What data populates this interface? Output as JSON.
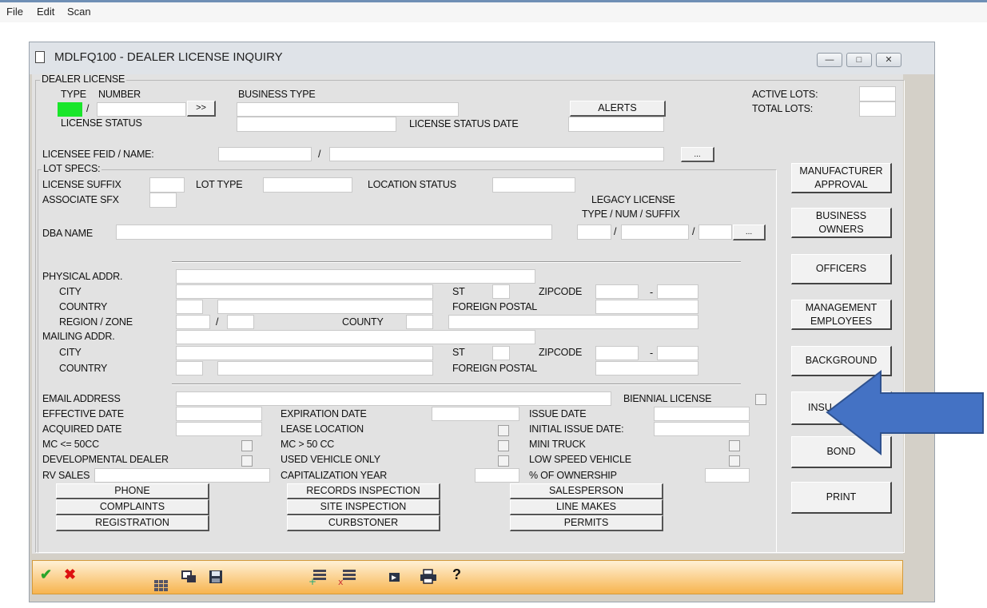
{
  "menu": [
    "File",
    "Edit",
    "Scan"
  ],
  "window": {
    "title": "MDLFQ100 - DEALER LICENSE INQUIRY",
    "controls": [
      "—",
      "□",
      "✕"
    ]
  },
  "dealer_license": {
    "group_label": "DEALER LICENSE",
    "type_label": "TYPE",
    "number_label": "NUMBER",
    "slash": "/",
    "lookup_button": ">>",
    "business_type_label": "BUSINESS TYPE",
    "alerts_button": "ALERTS",
    "active_lots_label": "ACTIVE LOTS:",
    "total_lots_label": "TOTAL LOTS:",
    "license_status_label": "LICENSE STATUS",
    "license_status_date_label": "LICENSE STATUS DATE",
    "type_indicator_color": "#19e62a"
  },
  "licensee": {
    "feid_label": "LICENSEE FEID / NAME:",
    "slash": "/",
    "browse_button": "..."
  },
  "lot_specs": {
    "group_label": "LOT SPECS:",
    "license_suffix_label": "LICENSE SUFFIX",
    "lot_type_label": "LOT TYPE",
    "location_status_label": "LOCATION STATUS",
    "associate_sfx_label": "ASSOCIATE SFX",
    "legacy_license_label": "LEGACY LICENSE",
    "legacy_sub_label": "TYPE / NUM / SUFFIX",
    "dba_name_label": "DBA NAME",
    "slash": "/",
    "browse_button": "..."
  },
  "address": {
    "physical_label": "PHYSICAL ADDR.",
    "city_label": "CITY",
    "st_label": "ST",
    "zipcode_label": "ZIPCODE",
    "dash": "-",
    "country_label": "COUNTRY",
    "foreign_postal_label": "FOREIGN POSTAL",
    "region_label": "REGION / ZONE",
    "county_label": "COUNTY",
    "slash": "/",
    "mailing_label": "MAILING ADDR."
  },
  "details": {
    "email_label": "EMAIL ADDRESS",
    "biennial_label": "BIENNIAL LICENSE",
    "effective_date_label": "EFFECTIVE DATE",
    "expiration_date_label": "EXPIRATION DATE",
    "issue_date_label": "ISSUE DATE",
    "acquired_date_label": "ACQUIRED DATE",
    "lease_location_label": "LEASE LOCATION",
    "initial_issue_date_label": "INITIAL ISSUE DATE:",
    "mc_le_50_label": "MC <= 50CC",
    "mc_gt_50_label": "MC > 50 CC",
    "mini_truck_label": "MINI TRUCK",
    "developmental_label": "DEVELOPMENTAL DEALER",
    "used_vehicle_label": "USED VEHICLE ONLY",
    "low_speed_label": "LOW SPEED VEHICLE",
    "rv_sales_label": "RV SALES",
    "capitalization_label": "CAPITALIZATION YEAR",
    "ownership_label": "% OF OWNERSHIP"
  },
  "bottom_buttons": {
    "phone": "PHONE",
    "complaints": "COMPLAINTS",
    "registration": "REGISTRATION",
    "records_inspection": "RECORDS INSPECTION",
    "site_inspection": "SITE INSPECTION",
    "curbstoner": "CURBSTONER",
    "salesperson": "SALESPERSON",
    "line_makes": "LINE MAKES",
    "permits": "PERMITS"
  },
  "side_buttons": {
    "manufacturer_1": "MANUFACTURER",
    "manufacturer_2": "APPROVAL",
    "business_1": "BUSINESS",
    "business_2": "OWNERS",
    "officers": "OFFICERS",
    "management_1": "MANAGEMENT",
    "management_2": "EMPLOYEES",
    "background": "BACKGROUND",
    "insurance_visible": "INSU",
    "bond": "BOND",
    "print": "PRINT"
  },
  "annotation": {
    "arrow_color": "#4472c4"
  },
  "toolbar": {
    "ok_icon": "✔",
    "cancel_icon": "✖",
    "help_icon": "?"
  }
}
